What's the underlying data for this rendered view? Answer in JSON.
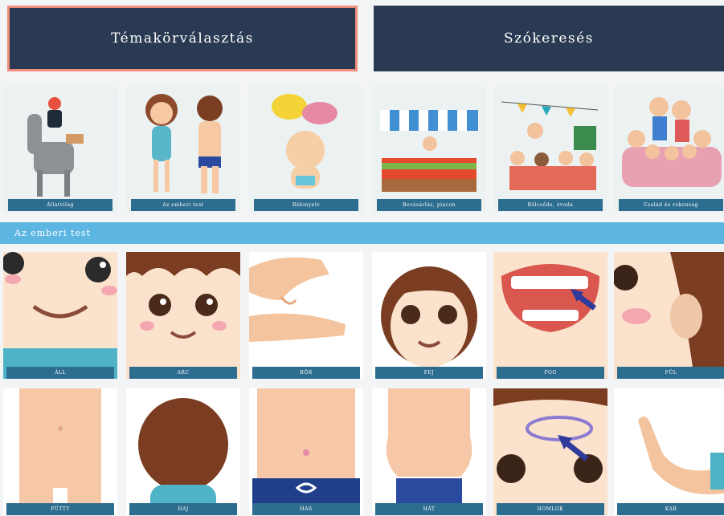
{
  "header": {
    "topics_label": "Témakörválasztás",
    "search_label": "Szókeresés"
  },
  "categories": [
    {
      "label": "Állatvilág"
    },
    {
      "label": "Az emberi test"
    },
    {
      "label": "Bébinyelv"
    },
    {
      "label": "Bevásárlás, piacon"
    },
    {
      "label": "Bölcsőde, óvoda"
    },
    {
      "label": "Család és rokonság"
    }
  ],
  "section": {
    "title": "Az emberi test"
  },
  "words": [
    {
      "label": "ÁLL"
    },
    {
      "label": "ARC"
    },
    {
      "label": "BŐR"
    },
    {
      "label": "FEJ"
    },
    {
      "label": "FOG"
    },
    {
      "label": "FÜL"
    },
    {
      "label": "FÜTTY"
    },
    {
      "label": "HAJ"
    },
    {
      "label": "HAS"
    },
    {
      "label": "HÁT"
    },
    {
      "label": "HOMLOK"
    },
    {
      "label": "KAR"
    }
  ]
}
